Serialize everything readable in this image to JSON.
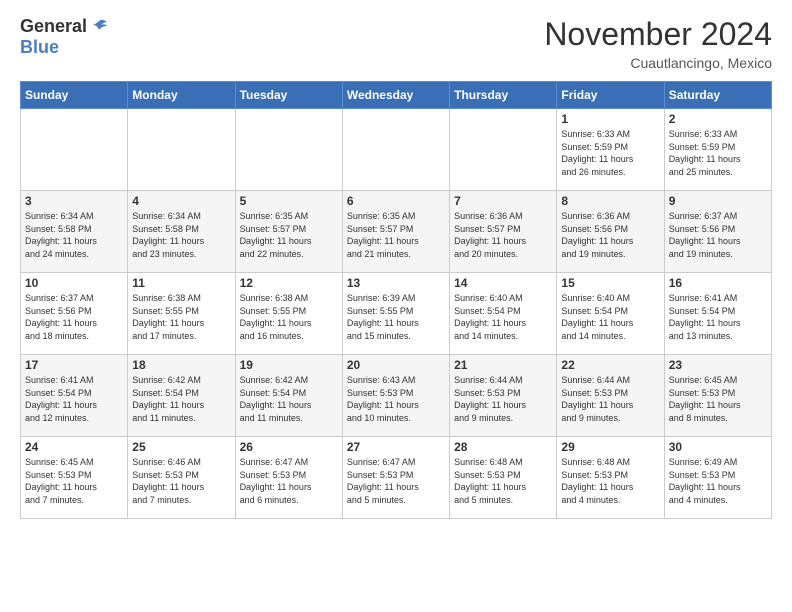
{
  "header": {
    "logo_general": "General",
    "logo_blue": "Blue",
    "month_title": "November 2024",
    "location": "Cuautlancingo, Mexico"
  },
  "days_of_week": [
    "Sunday",
    "Monday",
    "Tuesday",
    "Wednesday",
    "Thursday",
    "Friday",
    "Saturday"
  ],
  "weeks": [
    [
      {
        "day": "",
        "info": ""
      },
      {
        "day": "",
        "info": ""
      },
      {
        "day": "",
        "info": ""
      },
      {
        "day": "",
        "info": ""
      },
      {
        "day": "",
        "info": ""
      },
      {
        "day": "1",
        "info": "Sunrise: 6:33 AM\nSunset: 5:59 PM\nDaylight: 11 hours\nand 26 minutes."
      },
      {
        "day": "2",
        "info": "Sunrise: 6:33 AM\nSunset: 5:59 PM\nDaylight: 11 hours\nand 25 minutes."
      }
    ],
    [
      {
        "day": "3",
        "info": "Sunrise: 6:34 AM\nSunset: 5:58 PM\nDaylight: 11 hours\nand 24 minutes."
      },
      {
        "day": "4",
        "info": "Sunrise: 6:34 AM\nSunset: 5:58 PM\nDaylight: 11 hours\nand 23 minutes."
      },
      {
        "day": "5",
        "info": "Sunrise: 6:35 AM\nSunset: 5:57 PM\nDaylight: 11 hours\nand 22 minutes."
      },
      {
        "day": "6",
        "info": "Sunrise: 6:35 AM\nSunset: 5:57 PM\nDaylight: 11 hours\nand 21 minutes."
      },
      {
        "day": "7",
        "info": "Sunrise: 6:36 AM\nSunset: 5:57 PM\nDaylight: 11 hours\nand 20 minutes."
      },
      {
        "day": "8",
        "info": "Sunrise: 6:36 AM\nSunset: 5:56 PM\nDaylight: 11 hours\nand 19 minutes."
      },
      {
        "day": "9",
        "info": "Sunrise: 6:37 AM\nSunset: 5:56 PM\nDaylight: 11 hours\nand 19 minutes."
      }
    ],
    [
      {
        "day": "10",
        "info": "Sunrise: 6:37 AM\nSunset: 5:56 PM\nDaylight: 11 hours\nand 18 minutes."
      },
      {
        "day": "11",
        "info": "Sunrise: 6:38 AM\nSunset: 5:55 PM\nDaylight: 11 hours\nand 17 minutes."
      },
      {
        "day": "12",
        "info": "Sunrise: 6:38 AM\nSunset: 5:55 PM\nDaylight: 11 hours\nand 16 minutes."
      },
      {
        "day": "13",
        "info": "Sunrise: 6:39 AM\nSunset: 5:55 PM\nDaylight: 11 hours\nand 15 minutes."
      },
      {
        "day": "14",
        "info": "Sunrise: 6:40 AM\nSunset: 5:54 PM\nDaylight: 11 hours\nand 14 minutes."
      },
      {
        "day": "15",
        "info": "Sunrise: 6:40 AM\nSunset: 5:54 PM\nDaylight: 11 hours\nand 14 minutes."
      },
      {
        "day": "16",
        "info": "Sunrise: 6:41 AM\nSunset: 5:54 PM\nDaylight: 11 hours\nand 13 minutes."
      }
    ],
    [
      {
        "day": "17",
        "info": "Sunrise: 6:41 AM\nSunset: 5:54 PM\nDaylight: 11 hours\nand 12 minutes."
      },
      {
        "day": "18",
        "info": "Sunrise: 6:42 AM\nSunset: 5:54 PM\nDaylight: 11 hours\nand 11 minutes."
      },
      {
        "day": "19",
        "info": "Sunrise: 6:42 AM\nSunset: 5:54 PM\nDaylight: 11 hours\nand 11 minutes."
      },
      {
        "day": "20",
        "info": "Sunrise: 6:43 AM\nSunset: 5:53 PM\nDaylight: 11 hours\nand 10 minutes."
      },
      {
        "day": "21",
        "info": "Sunrise: 6:44 AM\nSunset: 5:53 PM\nDaylight: 11 hours\nand 9 minutes."
      },
      {
        "day": "22",
        "info": "Sunrise: 6:44 AM\nSunset: 5:53 PM\nDaylight: 11 hours\nand 9 minutes."
      },
      {
        "day": "23",
        "info": "Sunrise: 6:45 AM\nSunset: 5:53 PM\nDaylight: 11 hours\nand 8 minutes."
      }
    ],
    [
      {
        "day": "24",
        "info": "Sunrise: 6:45 AM\nSunset: 5:53 PM\nDaylight: 11 hours\nand 7 minutes."
      },
      {
        "day": "25",
        "info": "Sunrise: 6:46 AM\nSunset: 5:53 PM\nDaylight: 11 hours\nand 7 minutes."
      },
      {
        "day": "26",
        "info": "Sunrise: 6:47 AM\nSunset: 5:53 PM\nDaylight: 11 hours\nand 6 minutes."
      },
      {
        "day": "27",
        "info": "Sunrise: 6:47 AM\nSunset: 5:53 PM\nDaylight: 11 hours\nand 5 minutes."
      },
      {
        "day": "28",
        "info": "Sunrise: 6:48 AM\nSunset: 5:53 PM\nDaylight: 11 hours\nand 5 minutes."
      },
      {
        "day": "29",
        "info": "Sunrise: 6:48 AM\nSunset: 5:53 PM\nDaylight: 11 hours\nand 4 minutes."
      },
      {
        "day": "30",
        "info": "Sunrise: 6:49 AM\nSunset: 5:53 PM\nDaylight: 11 hours\nand 4 minutes."
      }
    ]
  ]
}
